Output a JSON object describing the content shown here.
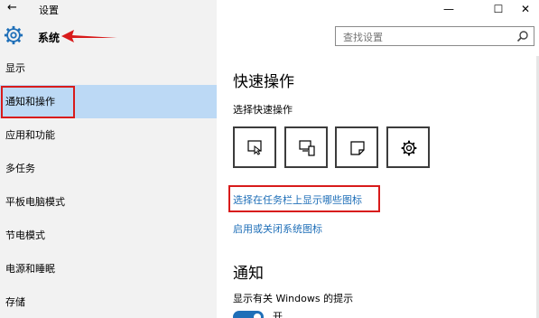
{
  "window": {
    "back_glyph": "←",
    "title": "设置",
    "minimize_glyph": "—",
    "maximize_glyph": "☐",
    "close_glyph": "✕"
  },
  "header": {
    "icon": "gear-icon",
    "section_title": "系统"
  },
  "search": {
    "placeholder": "查找设置",
    "icon": "search-icon"
  },
  "nav": {
    "items": [
      {
        "label": "显示"
      },
      {
        "label": "通知和操作",
        "active": true
      },
      {
        "label": "应用和功能"
      },
      {
        "label": "多任务"
      },
      {
        "label": "平板电脑模式"
      },
      {
        "label": "节电模式"
      },
      {
        "label": "电源和睡眠"
      },
      {
        "label": "存储"
      }
    ]
  },
  "main": {
    "quick_actions_heading": "快速操作",
    "quick_actions_sub": "选择快速操作",
    "tiles": [
      "tablet-mode-icon",
      "connect-icon",
      "note-icon",
      "settings-icon"
    ],
    "link_taskbar_icons": "选择在任务栏上显示哪些图标",
    "link_system_icons": "启用或关闭系统图标",
    "notifications_heading": "通知",
    "notifications_sub": "显示有关 Windows 的提示",
    "toggle_label": "开"
  },
  "colors": {
    "accent": "#1f6fb8",
    "highlight": "#d81b1b",
    "nav_active": "#bcd9f5"
  }
}
